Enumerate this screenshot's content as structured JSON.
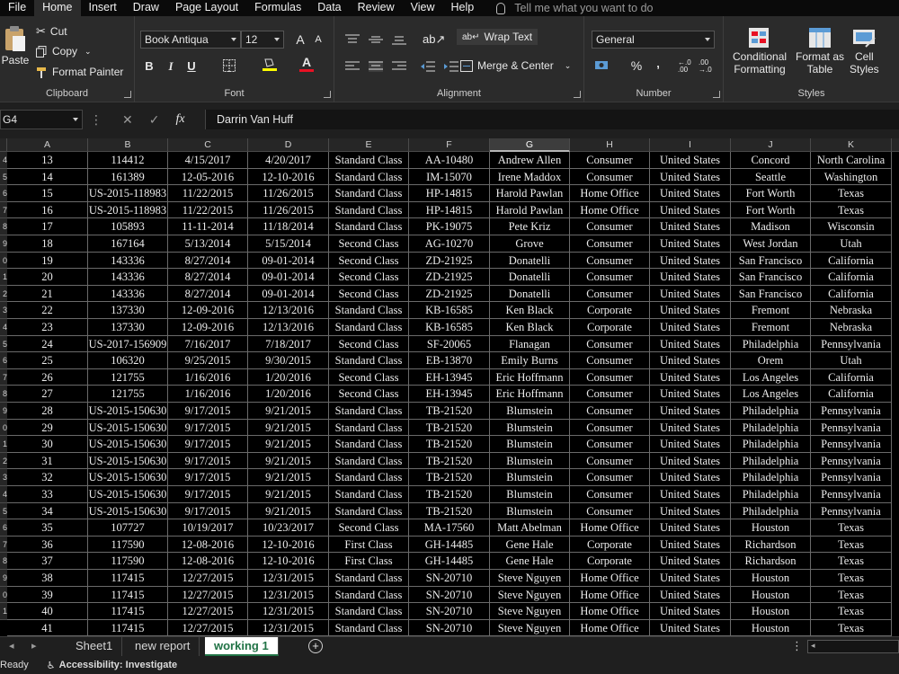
{
  "menu": {
    "tabs": [
      "File",
      "Home",
      "Insert",
      "Draw",
      "Page Layout",
      "Formulas",
      "Data",
      "Review",
      "View",
      "Help"
    ],
    "active": "Home",
    "tell_me": "Tell me what you want to do"
  },
  "ribbon": {
    "clipboard": {
      "paste": "Paste",
      "cut": "Cut",
      "copy": "Copy",
      "format_painter": "Format Painter",
      "label": "Clipboard"
    },
    "font": {
      "font_name": "Book Antiqua",
      "font_size": "12",
      "label": "Font",
      "bold": "B",
      "italic": "I",
      "underline": "U",
      "grow": "A",
      "shrink": "A",
      "font_color_glyph": "A"
    },
    "alignment": {
      "wrap_text": "Wrap Text",
      "merge_center": "Merge & Center",
      "label": "Alignment"
    },
    "number": {
      "format": "General",
      "label": "Number",
      "percent": "%",
      "comma": ","
    },
    "styles": {
      "conditional": "Conditional",
      "formatting": "Formatting",
      "format_as": "Format as",
      "table": "Table",
      "cell": "Cell",
      "cell_styles": "Styles",
      "label": "Styles"
    }
  },
  "formula_bar": {
    "name_box": "G4",
    "fx": "fx",
    "value": "Darrin Van Huff"
  },
  "columns": [
    "A",
    "B",
    "C",
    "D",
    "E",
    "F",
    "G",
    "H",
    "I",
    "J",
    "K"
  ],
  "selected_column": "G",
  "row_numbers": [
    "4",
    "5",
    "6",
    "7",
    "8",
    "9",
    "0",
    "1",
    "2",
    "3",
    "4",
    "5",
    "6",
    "7",
    "8",
    "9",
    "0",
    "1",
    "2",
    "3",
    "4",
    "5",
    "6",
    "7",
    "8",
    "9",
    "0",
    "1"
  ],
  "rows": [
    [
      "13",
      "114412",
      "4/15/2017",
      "4/20/2017",
      "Standard Class",
      "AA-10480",
      "Andrew Allen",
      "Consumer",
      "United States",
      "Concord",
      "North Carolina"
    ],
    [
      "14",
      "161389",
      "12-05-2016",
      "12-10-2016",
      "Standard Class",
      "IM-15070",
      "Irene Maddox",
      "Consumer",
      "United States",
      "Seattle",
      "Washington"
    ],
    [
      "15",
      "US-2015-118983",
      "11/22/2015",
      "11/26/2015",
      "Standard Class",
      "HP-14815",
      "Harold Pawlan",
      "Home Office",
      "United States",
      "Fort Worth",
      "Texas"
    ],
    [
      "16",
      "US-2015-118983",
      "11/22/2015",
      "11/26/2015",
      "Standard Class",
      "HP-14815",
      "Harold Pawlan",
      "Home Office",
      "United States",
      "Fort Worth",
      "Texas"
    ],
    [
      "17",
      "105893",
      "11-11-2014",
      "11/18/2014",
      "Standard Class",
      "PK-19075",
      "Pete Kriz",
      "Consumer",
      "United States",
      "Madison",
      "Wisconsin"
    ],
    [
      "18",
      "167164",
      "5/13/2014",
      "5/15/2014",
      "Second Class",
      "AG-10270",
      "Grove",
      "Consumer",
      "United States",
      "West Jordan",
      "Utah"
    ],
    [
      "19",
      "143336",
      "8/27/2014",
      "09-01-2014",
      "Second Class",
      "ZD-21925",
      "Donatelli",
      "Consumer",
      "United States",
      "San Francisco",
      "California"
    ],
    [
      "20",
      "143336",
      "8/27/2014",
      "09-01-2014",
      "Second Class",
      "ZD-21925",
      "Donatelli",
      "Consumer",
      "United States",
      "San Francisco",
      "California"
    ],
    [
      "21",
      "143336",
      "8/27/2014",
      "09-01-2014",
      "Second Class",
      "ZD-21925",
      "Donatelli",
      "Consumer",
      "United States",
      "San Francisco",
      "California"
    ],
    [
      "22",
      "137330",
      "12-09-2016",
      "12/13/2016",
      "Standard Class",
      "KB-16585",
      "Ken Black",
      "Corporate",
      "United States",
      "Fremont",
      "Nebraska"
    ],
    [
      "23",
      "137330",
      "12-09-2016",
      "12/13/2016",
      "Standard Class",
      "KB-16585",
      "Ken Black",
      "Corporate",
      "United States",
      "Fremont",
      "Nebraska"
    ],
    [
      "24",
      "US-2017-156909",
      "7/16/2017",
      "7/18/2017",
      "Second Class",
      "SF-20065",
      "Flanagan",
      "Consumer",
      "United States",
      "Philadelphia",
      "Pennsylvania"
    ],
    [
      "25",
      "106320",
      "9/25/2015",
      "9/30/2015",
      "Standard Class",
      "EB-13870",
      "Emily Burns",
      "Consumer",
      "United States",
      "Orem",
      "Utah"
    ],
    [
      "26",
      "121755",
      "1/16/2016",
      "1/20/2016",
      "Second Class",
      "EH-13945",
      "Eric Hoffmann",
      "Consumer",
      "United States",
      "Los Angeles",
      "California"
    ],
    [
      "27",
      "121755",
      "1/16/2016",
      "1/20/2016",
      "Second Class",
      "EH-13945",
      "Eric Hoffmann",
      "Consumer",
      "United States",
      "Los Angeles",
      "California"
    ],
    [
      "28",
      "US-2015-150630",
      "9/17/2015",
      "9/21/2015",
      "Standard Class",
      "TB-21520",
      "Blumstein",
      "Consumer",
      "United States",
      "Philadelphia",
      "Pennsylvania"
    ],
    [
      "29",
      "US-2015-150630",
      "9/17/2015",
      "9/21/2015",
      "Standard Class",
      "TB-21520",
      "Blumstein",
      "Consumer",
      "United States",
      "Philadelphia",
      "Pennsylvania"
    ],
    [
      "30",
      "US-2015-150630",
      "9/17/2015",
      "9/21/2015",
      "Standard Class",
      "TB-21520",
      "Blumstein",
      "Consumer",
      "United States",
      "Philadelphia",
      "Pennsylvania"
    ],
    [
      "31",
      "US-2015-150630",
      "9/17/2015",
      "9/21/2015",
      "Standard Class",
      "TB-21520",
      "Blumstein",
      "Consumer",
      "United States",
      "Philadelphia",
      "Pennsylvania"
    ],
    [
      "32",
      "US-2015-150630",
      "9/17/2015",
      "9/21/2015",
      "Standard Class",
      "TB-21520",
      "Blumstein",
      "Consumer",
      "United States",
      "Philadelphia",
      "Pennsylvania"
    ],
    [
      "33",
      "US-2015-150630",
      "9/17/2015",
      "9/21/2015",
      "Standard Class",
      "TB-21520",
      "Blumstein",
      "Consumer",
      "United States",
      "Philadelphia",
      "Pennsylvania"
    ],
    [
      "34",
      "US-2015-150630",
      "9/17/2015",
      "9/21/2015",
      "Standard Class",
      "TB-21520",
      "Blumstein",
      "Consumer",
      "United States",
      "Philadelphia",
      "Pennsylvania"
    ],
    [
      "35",
      "107727",
      "10/19/2017",
      "10/23/2017",
      "Second Class",
      "MA-17560",
      "Matt Abelman",
      "Home Office",
      "United States",
      "Houston",
      "Texas"
    ],
    [
      "36",
      "117590",
      "12-08-2016",
      "12-10-2016",
      "First Class",
      "GH-14485",
      "Gene Hale",
      "Corporate",
      "United States",
      "Richardson",
      "Texas"
    ],
    [
      "37",
      "117590",
      "12-08-2016",
      "12-10-2016",
      "First Class",
      "GH-14485",
      "Gene Hale",
      "Corporate",
      "United States",
      "Richardson",
      "Texas"
    ],
    [
      "38",
      "117415",
      "12/27/2015",
      "12/31/2015",
      "Standard Class",
      "SN-20710",
      "Steve Nguyen",
      "Home Office",
      "United States",
      "Houston",
      "Texas"
    ],
    [
      "39",
      "117415",
      "12/27/2015",
      "12/31/2015",
      "Standard Class",
      "SN-20710",
      "Steve Nguyen",
      "Home Office",
      "United States",
      "Houston",
      "Texas"
    ],
    [
      "40",
      "117415",
      "12/27/2015",
      "12/31/2015",
      "Standard Class",
      "SN-20710",
      "Steve Nguyen",
      "Home Office",
      "United States",
      "Houston",
      "Texas"
    ],
    [
      "41",
      "117415",
      "12/27/2015",
      "12/31/2015",
      "Standard Class",
      "SN-20710",
      "Steve Nguyen",
      "Home Office",
      "United States",
      "Houston",
      "Texas"
    ]
  ],
  "sheet_tabs": [
    "Sheet1",
    "new report",
    "working 1"
  ],
  "active_sheet": "working 1",
  "status": {
    "ready": "Ready",
    "accessibility": "Accessibility: Investigate"
  },
  "colors": {
    "accent": "#217346",
    "font_color_bar": "#e81123",
    "highlight_bar": "#ffff00"
  }
}
